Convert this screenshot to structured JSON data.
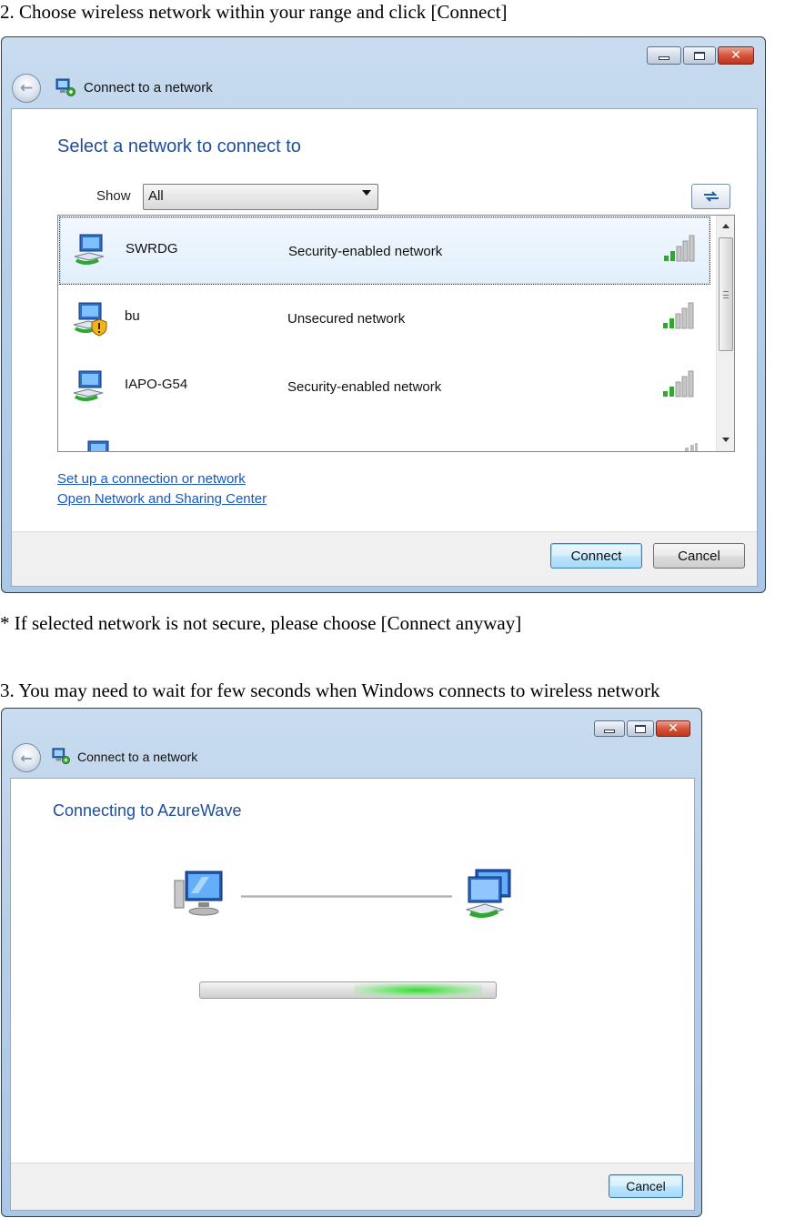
{
  "step2_text": "2. Choose wireless network within your range and click [Connect]",
  "note_text": "* If selected network is not secure, please choose [Connect anyway]",
  "step3_text": "3. You may need to wait for few seconds when Windows connects to wireless network",
  "window1": {
    "title": "Connect to a network",
    "heading": "Select a network to connect to",
    "show_label": "Show",
    "show_value": "All",
    "networks": [
      {
        "name": "SWRDG",
        "security": "Security-enabled network",
        "selected": true
      },
      {
        "name": "bu",
        "security": "Unsecured network",
        "selected": false
      },
      {
        "name": "IAPO-G54",
        "security": "Security-enabled network",
        "selected": false
      }
    ],
    "links": {
      "setup": "Set up a connection or network",
      "sharing_center": "Open Network and Sharing Center"
    },
    "buttons": {
      "connect": "Connect",
      "cancel": "Cancel"
    }
  },
  "window2": {
    "title": "Connect to a network",
    "heading": "Connecting to AzureWave",
    "buttons": {
      "cancel": "Cancel"
    }
  },
  "colors": {
    "heading_blue": "#1e4d9c",
    "link_blue": "#1656c5",
    "progress_green": "#3ad53a",
    "signal_green": "#2fa82f",
    "close_red": "#c0361d"
  },
  "icons": [
    "back-arrow-icon",
    "network-title-icon",
    "minimize-icon",
    "maximize-icon",
    "close-icon",
    "refresh-icon",
    "wireless-network-icon",
    "warning-shield-icon",
    "signal-strength-icon",
    "computer-icon"
  ]
}
